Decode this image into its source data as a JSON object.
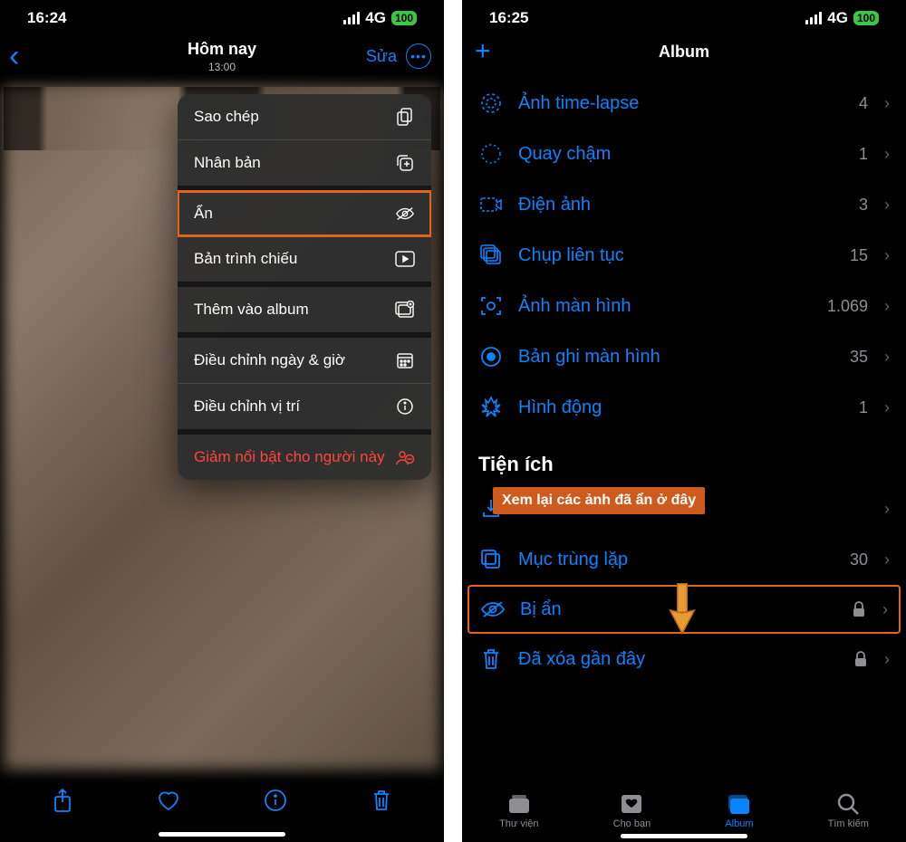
{
  "left": {
    "status": {
      "time": "16:24",
      "net": "4G",
      "battery": "100"
    },
    "nav": {
      "title": "Hôm nay",
      "subtitle": "13:00",
      "edit": "Sửa"
    },
    "menu": {
      "copy": "Sao chép",
      "duplicate": "Nhân bản",
      "hide": "Ẩn",
      "slideshow": "Bản trình chiếu",
      "add_to_album": "Thêm vào album",
      "adjust_datetime": "Điều chỉnh ngày & giờ",
      "adjust_location": "Điều chỉnh vị trí",
      "feature_less": "Giảm nổi bật cho người này"
    }
  },
  "right": {
    "status": {
      "time": "16:25",
      "net": "4G",
      "battery": "100"
    },
    "header": {
      "title": "Album"
    },
    "rows": {
      "timelapse": {
        "label": "Ảnh time-lapse",
        "count": "4"
      },
      "slomo": {
        "label": "Quay chậm",
        "count": "1"
      },
      "cinematic": {
        "label": "Điện ảnh",
        "count": "3"
      },
      "burst": {
        "label": "Chụp liên tục",
        "count": "15"
      },
      "screenshot": {
        "label": "Ảnh màn hình",
        "count": "1.069"
      },
      "screenrec": {
        "label": "Bản ghi màn hình",
        "count": "35"
      },
      "animated": {
        "label": "Hình động",
        "count": "1"
      },
      "section": "Tiện ích",
      "duplicates": {
        "label": "Mục trùng lặp",
        "count": "30"
      },
      "hidden": {
        "label": "Bị ẩn"
      },
      "deleted": {
        "label": "Đã xóa gần đây"
      }
    },
    "callout": "Xem lại các ảnh đã ẩn ở đây",
    "tabs": {
      "library": "Thư viện",
      "foryou": "Cho bạn",
      "album": "Album",
      "search": "Tìm kiếm"
    }
  }
}
